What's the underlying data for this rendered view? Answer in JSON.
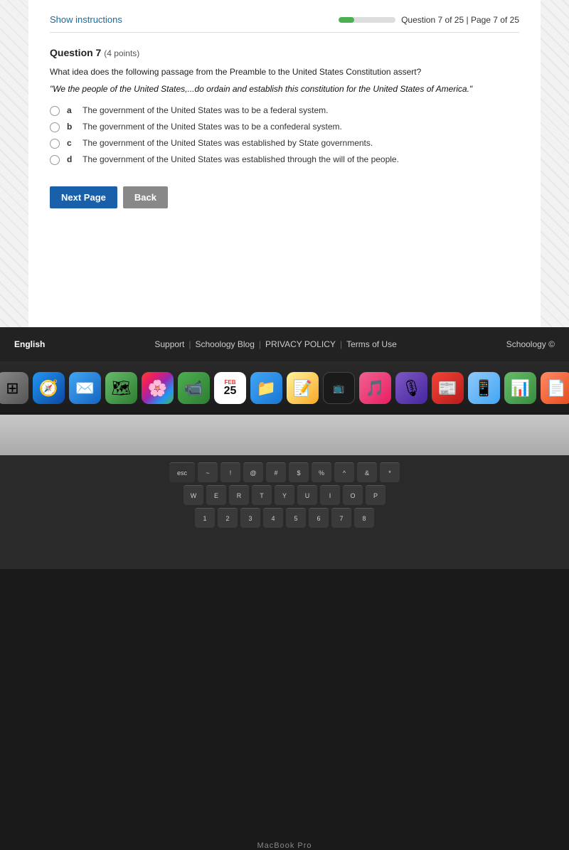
{
  "header": {
    "show_instructions": "Show instructions",
    "question_counter": "Question 7 of 25 | Page 7 of 25",
    "progress_percent": 28
  },
  "question": {
    "number": "Question 7",
    "points": "(4 points)",
    "passage_intro": "What idea does the following passage from the Preamble to the United States Constitution assert?",
    "passage_quote": "\"We the people of the United States,...do ordain and establish this constitution for the United States of America.\"",
    "choices": [
      {
        "letter": "a",
        "text": "The government of the United States was to be a federal system."
      },
      {
        "letter": "b",
        "text": "The government of the United States was to be a confederal system."
      },
      {
        "letter": "c",
        "text": "The government of the United States was established by State governments."
      },
      {
        "letter": "d",
        "text": "The government of the United States was established through the will of the people."
      }
    ]
  },
  "buttons": {
    "next_page": "Next Page",
    "back": "Back"
  },
  "footer": {
    "language": "English",
    "support": "Support",
    "schoology_blog": "Schoology Blog",
    "privacy_policy": "PRIVACY POLICY",
    "terms_of_use": "Terms of Use",
    "schoology_copyright": "Schoology ©"
  },
  "macbook": {
    "label": "MacBook Pro"
  },
  "keyboard": {
    "row1": [
      "esc",
      "~",
      "!",
      "@",
      "#",
      "$",
      "%",
      "^",
      "&",
      "*"
    ],
    "row2": [
      "W",
      "E",
      "R",
      "T",
      "Y",
      "U",
      "I",
      "O",
      "P"
    ],
    "row3": [
      "1",
      "2",
      "3",
      "4",
      "5",
      "6",
      "7",
      "8"
    ]
  }
}
